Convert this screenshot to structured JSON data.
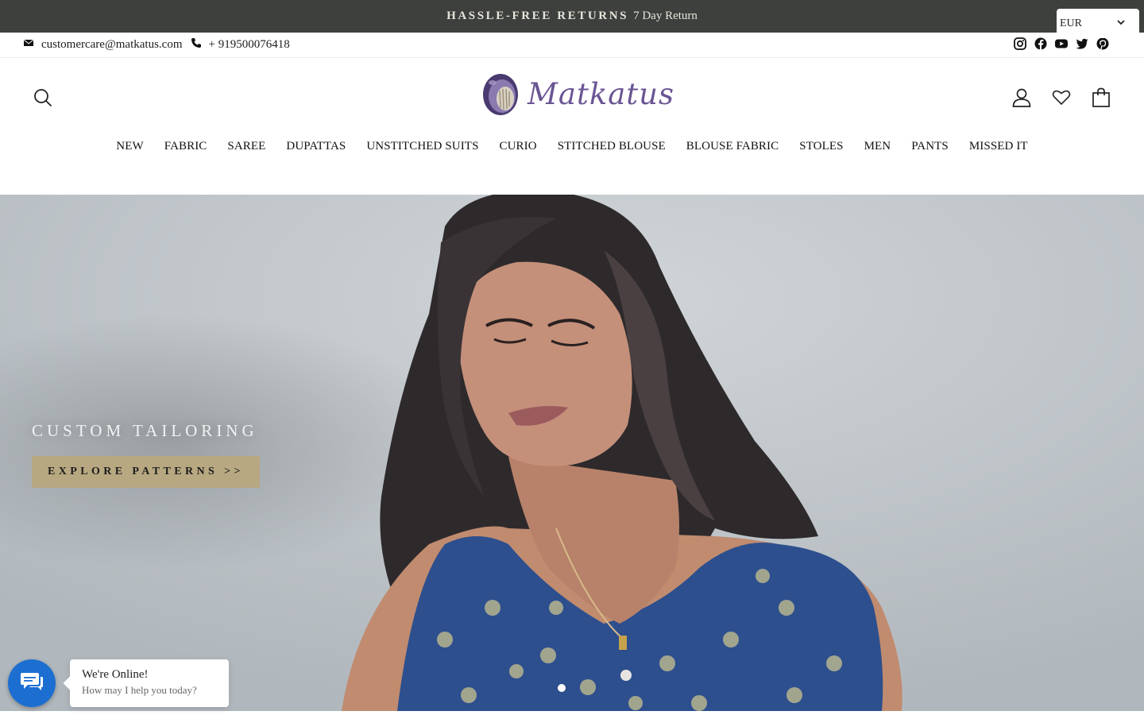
{
  "announcement": {
    "strong": "HASSLE-FREE RETURNS",
    "text": "7 Day Return"
  },
  "currency": {
    "value": "EUR"
  },
  "contact": {
    "email": "customercare@matkatus.com",
    "phone": "+ 919500076418"
  },
  "social": [
    "instagram-icon",
    "facebook-icon",
    "youtube-icon",
    "twitter-icon",
    "pinterest-icon"
  ],
  "brand": {
    "name": "Matkatus",
    "color": "#6a5594"
  },
  "nav": {
    "items": [
      "NEW",
      "FABRIC",
      "SAREE",
      "DUPATTAS",
      "UNSTITCHED SUITS",
      "CURIO",
      "STITCHED BLOUSE",
      "BLOUSE FABRIC",
      "STOLES",
      "MEN",
      "PANTS",
      "MISSED IT"
    ]
  },
  "hero": {
    "title": "CUSTOM TAILORING",
    "button": "EXPLORE PATTERNS >>",
    "button_color": "#b8a881"
  },
  "chat": {
    "title": "We're Online!",
    "subtitle": "How may I help you today?",
    "color": "#1c6fd1"
  },
  "colors": {
    "announcement_bg": "#3d403d"
  }
}
